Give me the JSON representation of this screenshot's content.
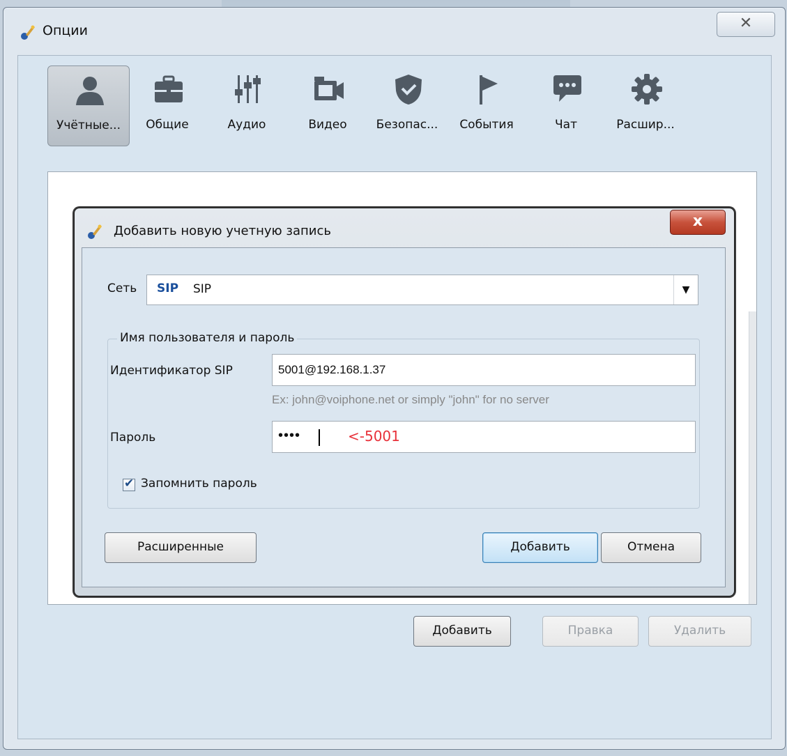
{
  "window": {
    "title": "Опции",
    "close": "✕"
  },
  "toolbar": [
    {
      "label": "Учётные...",
      "icon": "person-icon"
    },
    {
      "label": "Общие",
      "icon": "briefcase-icon"
    },
    {
      "label": "Аудио",
      "icon": "mixer-icon"
    },
    {
      "label": "Видео",
      "icon": "camera-icon"
    },
    {
      "label": "Безопас...",
      "icon": "shield-icon"
    },
    {
      "label": "События",
      "icon": "flag-icon"
    },
    {
      "label": "Чат",
      "icon": "chat-icon"
    },
    {
      "label": "Расшир...",
      "icon": "gear-icon"
    }
  ],
  "account_buttons": {
    "add": "Добавить",
    "edit": "Правка",
    "delete": "Удалить"
  },
  "dialog": {
    "title": "Добавить новую учетную запись",
    "close": "x",
    "network_label": "Сеть",
    "network_badge": "SIP",
    "network_value": "SIP",
    "group_title": "Имя пользователя и пароль",
    "sip_id_label": "Идентификатор SIP",
    "sip_id_value": "5001@192.168.1.37",
    "sip_hint": "Ex: john@voiphone.net or simply \"john\" for no server",
    "password_label": "Пароль",
    "password_value": "••••",
    "password_annotation": "<-5001",
    "remember_label": "Запомнить пароль",
    "remember_checked": true,
    "advanced_button": "Расширенные",
    "add_button": "Добавить",
    "cancel_button": "Отмена"
  },
  "colors": {
    "annotation": "#e8313a",
    "sip_badge": "#1a4f9c"
  }
}
